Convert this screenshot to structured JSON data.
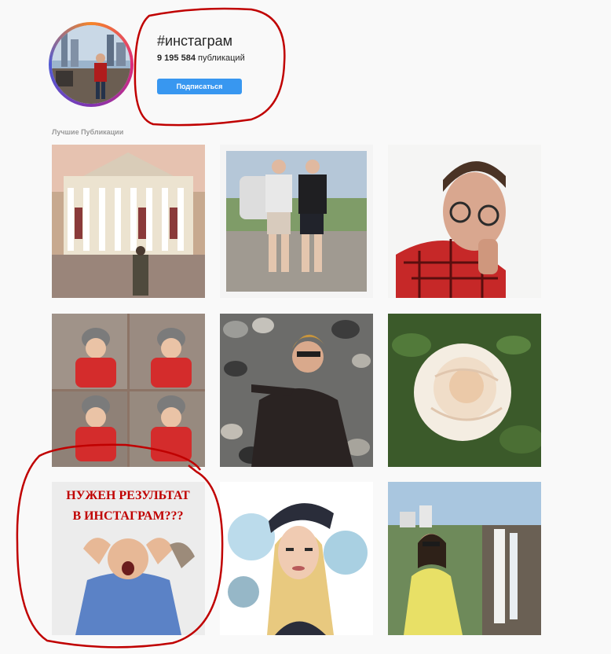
{
  "header": {
    "hashtag": "#инстаграм",
    "posts_count": "9 195 584",
    "posts_word": "публикаций",
    "follow_label": "Подписаться"
  },
  "top_posts": {
    "label": "Лучшие Публикации",
    "items": [
      {
        "name": "post-theater"
      },
      {
        "name": "post-two-men"
      },
      {
        "name": "post-man-glasses"
      },
      {
        "name": "post-baby-collage"
      },
      {
        "name": "post-man-stones"
      },
      {
        "name": "post-rose"
      },
      {
        "name": "post-result-ad",
        "text_line1": "НУЖЕН РЕЗУЛЬТАТ",
        "text_line2": "В ИНСТАГРАМ???"
      },
      {
        "name": "post-girl-art"
      },
      {
        "name": "post-waterfall-woman"
      }
    ]
  },
  "colors": {
    "accent": "#3897f0",
    "annotation": "#c00000",
    "ad_text": "#c00000"
  }
}
